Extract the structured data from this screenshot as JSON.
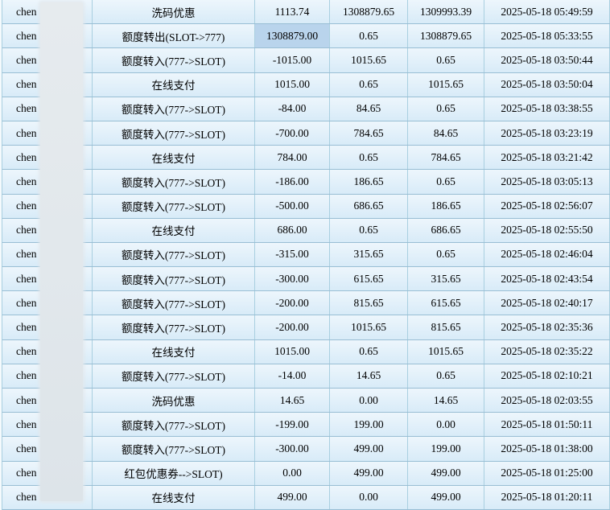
{
  "colors": {
    "row_bg_top": "#edf6fc",
    "row_bg_bottom": "#d8ebf8",
    "grid_line_h": "#99bed4",
    "grid_line_v": "#a9cfe0",
    "selected_cell_bg": "#b9d4ec",
    "redaction_overlay": "#e2e8ec",
    "text": "#000000"
  },
  "rows": [
    {
      "username": "chen",
      "type": "洗码优惠",
      "amount": "1113.74",
      "balance_before": "1308879.65",
      "balance_after": "1309993.39",
      "time": "2025-05-18 05:49:59",
      "amount_selected": false
    },
    {
      "username": "chen",
      "type": "额度转出(SLOT->777)",
      "amount": "1308879.00",
      "balance_before": "0.65",
      "balance_after": "1308879.65",
      "time": "2025-05-18 05:33:55",
      "amount_selected": true
    },
    {
      "username": "chen",
      "type": "额度转入(777->SLOT)",
      "amount": "-1015.00",
      "balance_before": "1015.65",
      "balance_after": "0.65",
      "time": "2025-05-18 03:50:44",
      "amount_selected": false
    },
    {
      "username": "chen",
      "type": "在线支付",
      "amount": "1015.00",
      "balance_before": "0.65",
      "balance_after": "1015.65",
      "time": "2025-05-18 03:50:04",
      "amount_selected": false
    },
    {
      "username": "chen",
      "type": "额度转入(777->SLOT)",
      "amount": "-84.00",
      "balance_before": "84.65",
      "balance_after": "0.65",
      "time": "2025-05-18 03:38:55",
      "amount_selected": false
    },
    {
      "username": "chen",
      "type": "额度转入(777->SLOT)",
      "amount": "-700.00",
      "balance_before": "784.65",
      "balance_after": "84.65",
      "time": "2025-05-18 03:23:19",
      "amount_selected": false
    },
    {
      "username": "chen",
      "type": "在线支付",
      "amount": "784.00",
      "balance_before": "0.65",
      "balance_after": "784.65",
      "time": "2025-05-18 03:21:42",
      "amount_selected": false
    },
    {
      "username": "chen",
      "type": "额度转入(777->SLOT)",
      "amount": "-186.00",
      "balance_before": "186.65",
      "balance_after": "0.65",
      "time": "2025-05-18 03:05:13",
      "amount_selected": false
    },
    {
      "username": "chen",
      "type": "额度转入(777->SLOT)",
      "amount": "-500.00",
      "balance_before": "686.65",
      "balance_after": "186.65",
      "time": "2025-05-18 02:56:07",
      "amount_selected": false
    },
    {
      "username": "chen",
      "type": "在线支付",
      "amount": "686.00",
      "balance_before": "0.65",
      "balance_after": "686.65",
      "time": "2025-05-18 02:55:50",
      "amount_selected": false
    },
    {
      "username": "chen",
      "type": "额度转入(777->SLOT)",
      "amount": "-315.00",
      "balance_before": "315.65",
      "balance_after": "0.65",
      "time": "2025-05-18 02:46:04",
      "amount_selected": false
    },
    {
      "username": "chen",
      "type": "额度转入(777->SLOT)",
      "amount": "-300.00",
      "balance_before": "615.65",
      "balance_after": "315.65",
      "time": "2025-05-18 02:43:54",
      "amount_selected": false
    },
    {
      "username": "chen",
      "type": "额度转入(777->SLOT)",
      "amount": "-200.00",
      "balance_before": "815.65",
      "balance_after": "615.65",
      "time": "2025-05-18 02:40:17",
      "amount_selected": false
    },
    {
      "username": "chen",
      "type": "额度转入(777->SLOT)",
      "amount": "-200.00",
      "balance_before": "1015.65",
      "balance_after": "815.65",
      "time": "2025-05-18 02:35:36",
      "amount_selected": false
    },
    {
      "username": "chen",
      "type": "在线支付",
      "amount": "1015.00",
      "balance_before": "0.65",
      "balance_after": "1015.65",
      "time": "2025-05-18 02:35:22",
      "amount_selected": false
    },
    {
      "username": "chen",
      "type": "额度转入(777->SLOT)",
      "amount": "-14.00",
      "balance_before": "14.65",
      "balance_after": "0.65",
      "time": "2025-05-18 02:10:21",
      "amount_selected": false
    },
    {
      "username": "chen",
      "type": "洗码优惠",
      "amount": "14.65",
      "balance_before": "0.00",
      "balance_after": "14.65",
      "time": "2025-05-18 02:03:55",
      "amount_selected": false
    },
    {
      "username": "chen",
      "type": "额度转入(777->SLOT)",
      "amount": "-199.00",
      "balance_before": "199.00",
      "balance_after": "0.00",
      "time": "2025-05-18 01:50:11",
      "amount_selected": false
    },
    {
      "username": "chen",
      "type": "额度转入(777->SLOT)",
      "amount": "-300.00",
      "balance_before": "499.00",
      "balance_after": "199.00",
      "time": "2025-05-18 01:38:00",
      "amount_selected": false
    },
    {
      "username": "chen",
      "type": "红包优惠券-->SLOT)",
      "amount": "0.00",
      "balance_before": "499.00",
      "balance_after": "499.00",
      "time": "2025-05-18 01:25:00",
      "amount_selected": false
    },
    {
      "username": "chen",
      "type": "在线支付",
      "amount": "499.00",
      "balance_before": "0.00",
      "balance_after": "499.00",
      "time": "2025-05-18 01:20:11",
      "amount_selected": false
    }
  ]
}
